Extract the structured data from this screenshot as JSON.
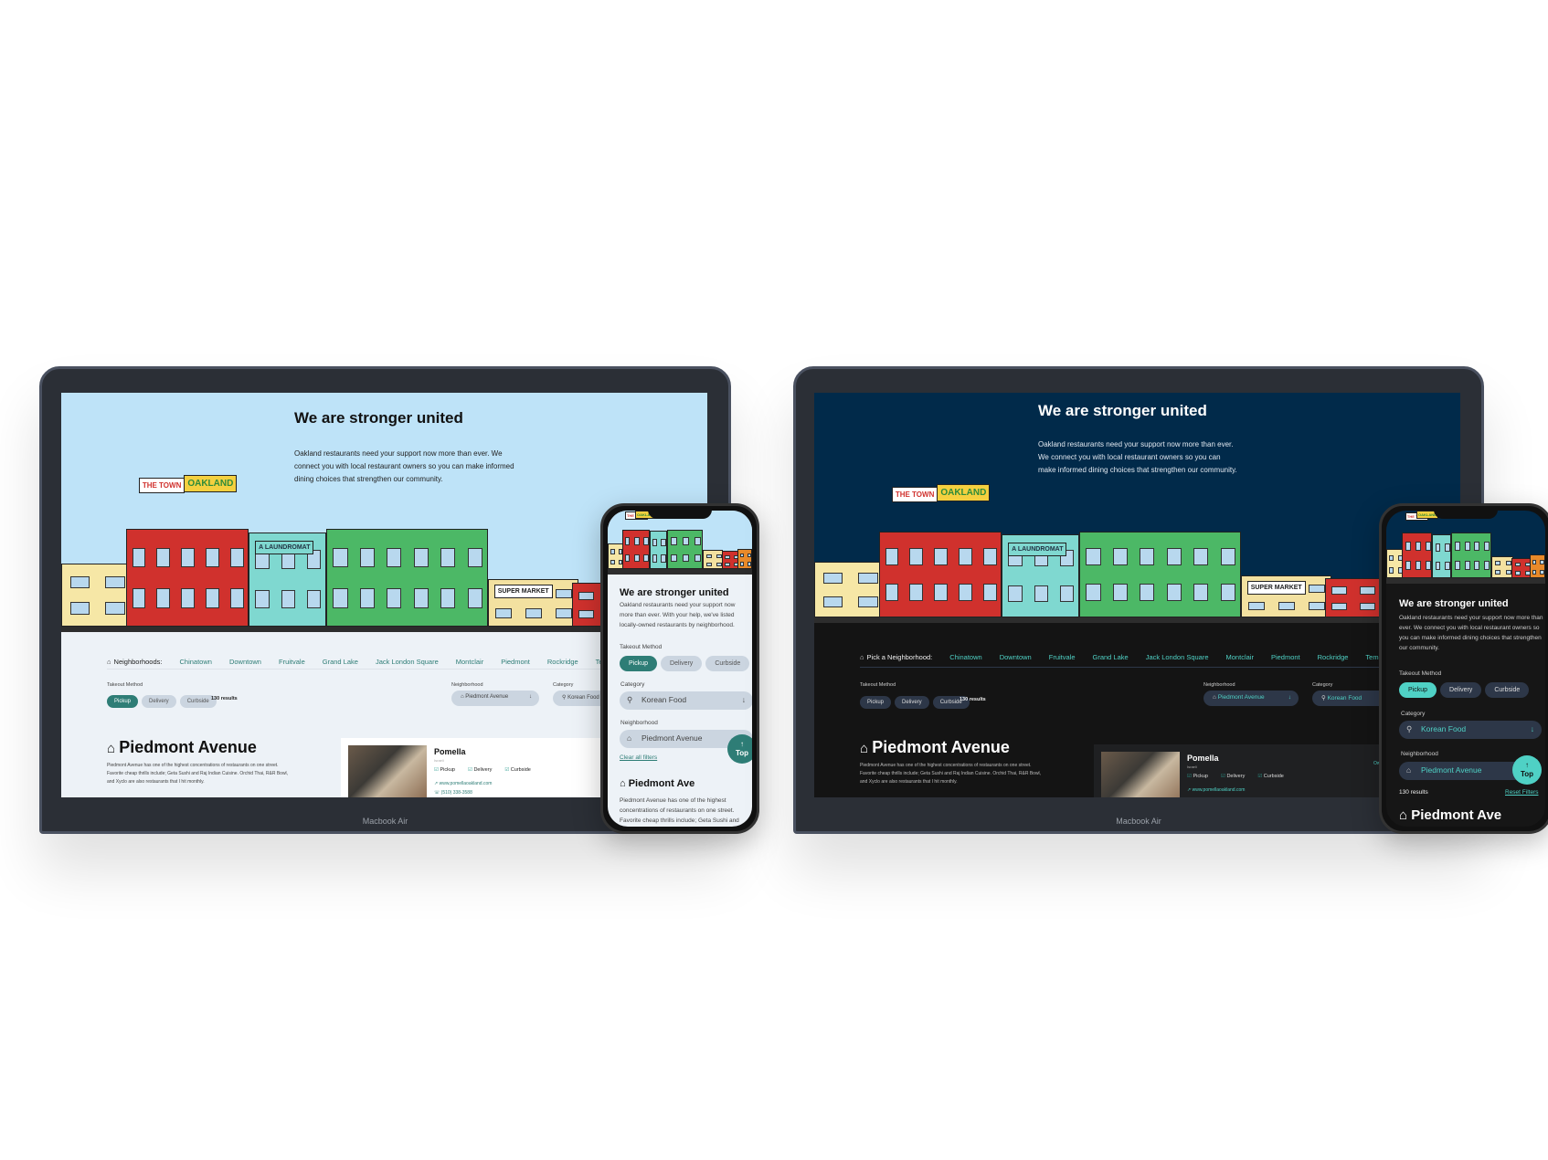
{
  "hero": {
    "title": "We are stronger united",
    "text": "Oakland restaurants need your support now more than ever. We connect you with local restaurant owners so you can make informed dining choices that strengthen our community.",
    "mobile_light_text": "Oakland restaurants need your support now more than ever. With your help, we've listed locally-owned restaurants by neighborhood."
  },
  "signs": {
    "the_town": "THE TOWN",
    "oakland": "OAKLAND",
    "laundromat": "A LAUNDROMAT",
    "supermarket": "SUPER MARKET"
  },
  "nav": {
    "light_label": "Neighborhoods:",
    "dark_label": "Pick a Neighborhood:",
    "items": [
      "Chinatown",
      "Downtown",
      "Fruitvale",
      "Grand Lake",
      "Jack London Square",
      "Montclair",
      "Piedmont",
      "Rockridge",
      "Temescal"
    ]
  },
  "filters": {
    "takeout_label": "Takeout Method",
    "methods": [
      "Pickup",
      "Delivery",
      "Curbside"
    ],
    "results": "130 results",
    "neighborhood_label": "Neighborhood",
    "neighborhood_value": "Piedmont Avenue",
    "category_label": "Category",
    "category_value": "Korean Food",
    "clear": "Clear all filters",
    "reset": "Reset Filters"
  },
  "section": {
    "title": "Piedmont Avenue",
    "mobile_title": "Piedmont Ave",
    "text": "Piedmont Avenue has one of the highest concentrations of restaurants on one street. Favorite cheap thrills include; Geta Sushi and Raj Indian Cuisine. Orchid Thai, R&R Bowl, and Xyclo are also restaurants that I hit monthly.",
    "mobile_text": "Piedmont Avenue has one of the highest concentrations of restaurants on one street. Favorite cheap thrills include; Geta Sushi and Raj..."
  },
  "card": {
    "name": "Pomella",
    "cuisine": "Israeli",
    "options": [
      "Pickup",
      "Delivery",
      "Curbside"
    ],
    "website": "www.pomellaoakland.com",
    "phone": "(510) 338-3588",
    "owner_badge": "Ow"
  },
  "top_button": "Top",
  "device_label": "Macbook Air",
  "colors": {
    "teal": "#2e7d76",
    "mint": "#4fd1c5",
    "sky": "#bee3f8",
    "navy": "#012a4a",
    "dark": "#141414"
  }
}
